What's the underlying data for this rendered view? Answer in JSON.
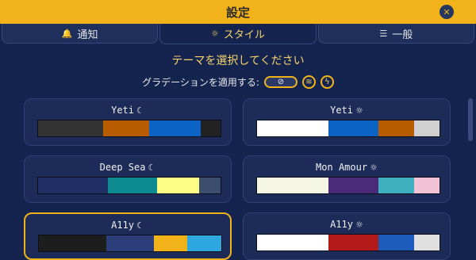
{
  "window": {
    "title": "設定",
    "close_icon": "✕"
  },
  "tabs": [
    {
      "label": "通知",
      "icon": "🔔",
      "icon_name": "bell-icon",
      "active": false
    },
    {
      "label": "スタイル",
      "icon": "☼",
      "icon_name": "sun-icon",
      "active": true
    },
    {
      "label": "一般",
      "icon": "☰",
      "icon_name": "list-icon",
      "active": false
    }
  ],
  "section": {
    "title": "テーマを選択してください"
  },
  "gradient": {
    "label": "グラデーションを適用する:",
    "options": [
      {
        "name": "none",
        "icon": "⊘",
        "selected": true
      },
      {
        "name": "waves",
        "icon": "≋",
        "selected": false
      },
      {
        "name": "lightning",
        "icon": "ϟ",
        "selected": false
      }
    ]
  },
  "themes": [
    {
      "name": "Yeti",
      "mode_icon": "☾",
      "mode": "dark",
      "selected": false,
      "colors": [
        "#333333",
        "#b85c00",
        "#0b63c6",
        "#222222"
      ],
      "weights": [
        2,
        1.4,
        1.6,
        0.6
      ]
    },
    {
      "name": "Yeti",
      "mode_icon": "☼",
      "mode": "light",
      "selected": false,
      "colors": [
        "#ffffff",
        "#0b63c6",
        "#b85c00",
        "#d0d0d0"
      ],
      "weights": [
        2,
        1.4,
        1,
        0.7
      ]
    },
    {
      "name": "Deep Sea",
      "mode_icon": "☾",
      "mode": "dark",
      "selected": false,
      "colors": [
        "#1f2f66",
        "#0d8a91",
        "#fdfd85",
        "#3b4e6e"
      ],
      "weights": [
        2,
        1.4,
        1.2,
        0.6
      ]
    },
    {
      "name": "Mon Amour",
      "mode_icon": "☼",
      "mode": "light",
      "selected": false,
      "colors": [
        "#f6f7e3",
        "#4b2a7a",
        "#3eb0c0",
        "#f2c3d4"
      ],
      "weights": [
        2,
        1.4,
        1,
        0.7
      ]
    },
    {
      "name": "A11y",
      "mode_icon": "☾",
      "mode": "dark",
      "selected": true,
      "colors": [
        "#1d1d1d",
        "#2b3e7a",
        "#f2b21a",
        "#2ea7e0"
      ],
      "weights": [
        2,
        1.4,
        1,
        1
      ]
    },
    {
      "name": "A11y",
      "mode_icon": "☼",
      "mode": "light",
      "selected": false,
      "colors": [
        "#ffffff",
        "#b31b1b",
        "#1d5bbd",
        "#e0e0e0"
      ],
      "weights": [
        2,
        1.4,
        1,
        0.7
      ]
    }
  ]
}
